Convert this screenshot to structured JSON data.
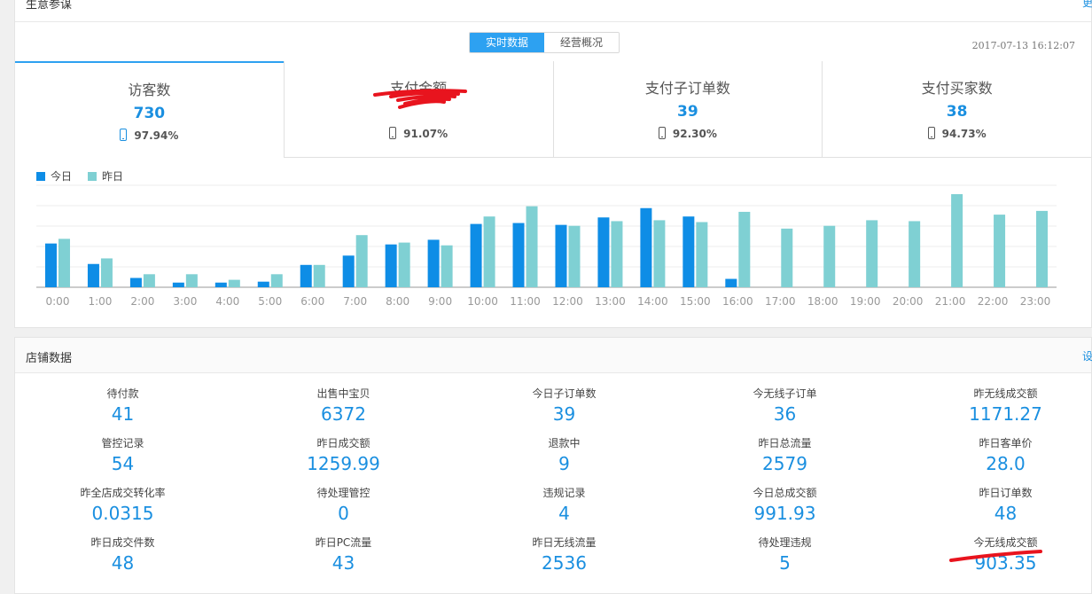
{
  "panel1": {
    "title": "生意参谋",
    "more": "更",
    "tabs": [
      "实时数据",
      "经营概况"
    ],
    "datetime": "2017-07-13 16:12:07",
    "metrics": [
      {
        "label": "访客数",
        "value": "730",
        "sub": "97.94%"
      },
      {
        "label": "支付金额",
        "value": "",
        "sub": "91.07%"
      },
      {
        "label": "支付子订单数",
        "value": "39",
        "sub": "92.30%"
      },
      {
        "label": "支付买家数",
        "value": "38",
        "sub": "94.73%"
      }
    ],
    "legend": [
      "今日",
      "昨日"
    ]
  },
  "colors": {
    "today": "#0e8de6",
    "yesterday": "#7fd0d3",
    "accent": "#2da1f1",
    "red": "#e8141e"
  },
  "chart_data": {
    "type": "bar",
    "categories": [
      "0:00",
      "1:00",
      "2:00",
      "3:00",
      "4:00",
      "5:00",
      "6:00",
      "7:00",
      "8:00",
      "9:00",
      "10:00",
      "11:00",
      "12:00",
      "13:00",
      "14:00",
      "15:00",
      "16:00",
      "17:00",
      "18:00",
      "19:00",
      "20:00",
      "21:00",
      "22:00",
      "23:00"
    ],
    "series": [
      {
        "name": "今日",
        "values": [
          47,
          25,
          10,
          5,
          5,
          6,
          24,
          34,
          46,
          51,
          68,
          69,
          67,
          75,
          85,
          76,
          9,
          null,
          null,
          null,
          null,
          null,
          null,
          null
        ]
      },
      {
        "name": "昨日",
        "values": [
          52,
          31,
          14,
          14,
          8,
          14,
          24,
          56,
          48,
          45,
          76,
          87,
          66,
          71,
          72,
          70,
          81,
          63,
          66,
          72,
          71,
          100,
          78,
          82
        ]
      }
    ],
    "grid": true
  },
  "panel2": {
    "title": "店铺数据",
    "more": "设",
    "cells": [
      {
        "label": "待付款",
        "value": "41"
      },
      {
        "label": "出售中宝贝",
        "value": "6372"
      },
      {
        "label": "今日子订单数",
        "value": "39"
      },
      {
        "label": "今无线子订单",
        "value": "36"
      },
      {
        "label": "昨无线成交额",
        "value": "1171.27"
      },
      {
        "label": "管控记录",
        "value": "54"
      },
      {
        "label": "昨日成交额",
        "value": "1259.99"
      },
      {
        "label": "退款中",
        "value": "9"
      },
      {
        "label": "昨日总流量",
        "value": "2579"
      },
      {
        "label": "昨日客单价",
        "value": "28.0"
      },
      {
        "label": "昨全店成交转化率",
        "value": "0.0315"
      },
      {
        "label": "待处理管控",
        "value": "0"
      },
      {
        "label": "违规记录",
        "value": "4"
      },
      {
        "label": "今日总成交额",
        "value": "991.93"
      },
      {
        "label": "昨日订单数",
        "value": "48"
      },
      {
        "label": "昨日成交件数",
        "value": "48"
      },
      {
        "label": "昨日PC流量",
        "value": "43"
      },
      {
        "label": "昨日无线流量",
        "value": "2536"
      },
      {
        "label": "待处理违规",
        "value": "5"
      },
      {
        "label": "今无线成交额",
        "value": "903.35"
      }
    ]
  }
}
